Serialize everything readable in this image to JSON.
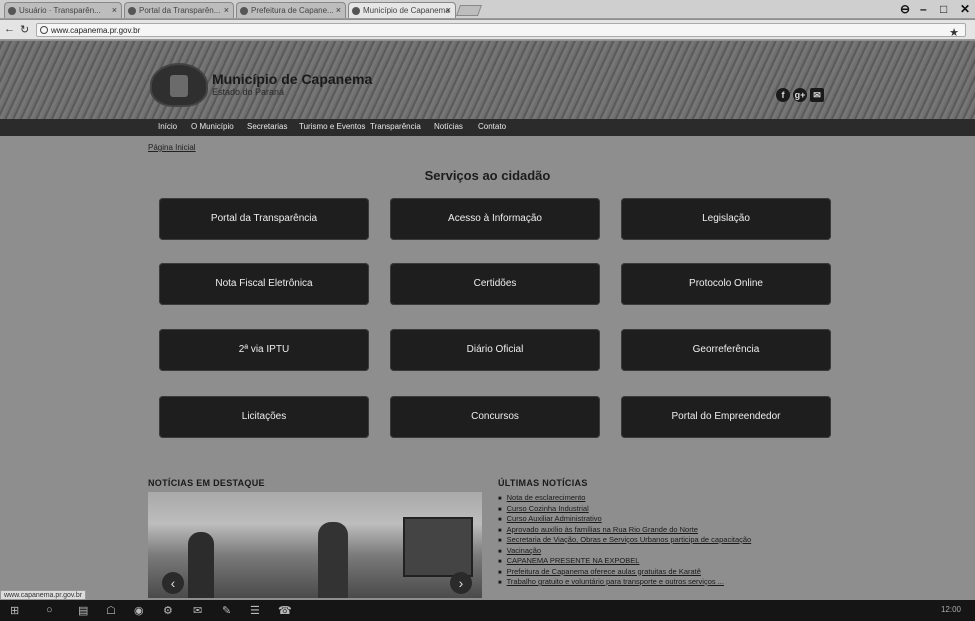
{
  "browser": {
    "tabs": [
      {
        "label": "Usuário · Transparên..."
      },
      {
        "label": "Portal da Transparên..."
      },
      {
        "label": "Prefeitura de Capane..."
      },
      {
        "label": "Município de Capanema"
      }
    ],
    "url": "www.capanema.pr.gov.br",
    "window_controls": [
      "⊖",
      "–",
      "□",
      "✕"
    ]
  },
  "site": {
    "title": "Município de Capanema",
    "subtitle": "Estado do Paraná",
    "social": [
      "f",
      "g+",
      "✉"
    ]
  },
  "nav": {
    "items": [
      "Início",
      "O Município",
      "Secretarias",
      "Turismo e Eventos",
      "Transparência",
      "Notícias",
      "Contato"
    ]
  },
  "breadcrumb": "Página Inicial",
  "services": {
    "title": "Serviços ao cidadão",
    "items": [
      "Portal da Transparência",
      "Acesso à Informação",
      "Legislação",
      "Nota Fiscal Eletrônica",
      "Certidões",
      "Protocolo Online",
      "2ª via IPTU",
      "Diário Oficial",
      "Georreferência",
      "Licitações",
      "Concursos",
      "Portal do Empreendedor"
    ]
  },
  "news": {
    "featured_title": "NOTÍCIAS EM DESTAQUE",
    "latest_title": "ÚLTIMAS NOTÍCIAS",
    "latest": [
      "Nota de esclarecimento",
      "Curso Cozinha Industrial",
      "Curso Auxiliar Administrativo",
      "Aprovado auxílio às famílias na Rua Rio Grande do Norte",
      "Secretaria de Viação, Obras e Serviços Urbanos participa de capacitação",
      "Vacinação",
      "CAPANEMA PRESENTE NA EXPOBEL",
      "Prefeitura de Capanema oferece aulas gratuitas de Karatê",
      "Trabalho gratuito e voluntário para transporte e outros serviços ..."
    ]
  },
  "status_url": "www.capanema.pr.gov.br",
  "taskbar": {
    "icons": [
      "⊞",
      "○",
      "▤",
      "☖",
      "◉",
      "⚙",
      "✉",
      "✎",
      "☰",
      "☎"
    ],
    "clock": "12:00"
  }
}
